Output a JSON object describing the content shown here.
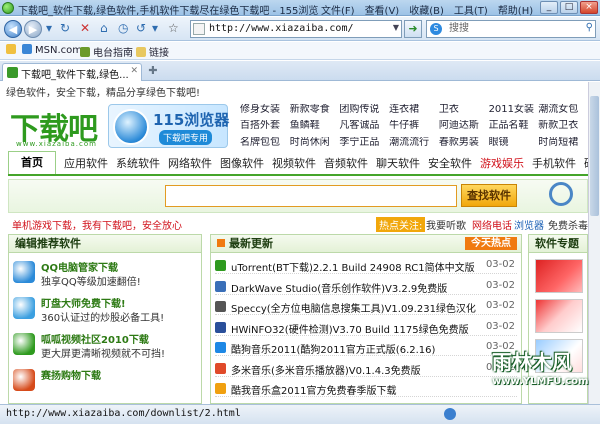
{
  "window": {
    "title": "下载吧_软件下载,绿色软件,手机软件下载尽在绿色下载吧 - 155浏览",
    "menu": [
      "文件(F)",
      "查看(V)",
      "收藏(B)",
      "工具(T)",
      "帮助(H)"
    ],
    "controls": {
      "minimize": "_",
      "maximize": "□",
      "close": "×"
    }
  },
  "navbar": {
    "address": "http://www.xiazaiba.com/",
    "search_placeholder": "搜搜"
  },
  "favorites": [
    {
      "label": "MSN.com",
      "icon": "msn-icon",
      "color": "#3a86d6"
    },
    {
      "label": "电台指南",
      "icon": "radio-icon",
      "color": "#6b9a2a"
    },
    {
      "label": "链接",
      "icon": "folder-icon",
      "color": "#e8c860"
    }
  ],
  "tab": {
    "label": "下载吧_软件下载,绿色..."
  },
  "page": {
    "topline": "绿色软件，安全下载，精品分享绿色下载吧!",
    "logo": {
      "text": "下载吧",
      "url": "www.xiazaiba.com"
    },
    "ad": {
      "title": "115浏览器",
      "subtitle": "下载吧专用"
    },
    "soft_links": [
      {
        "label": "修身女装",
        "red": false
      },
      {
        "label": "新款零食",
        "red": false
      },
      {
        "label": "团购传说",
        "red": false
      },
      {
        "label": "连衣裙",
        "red": false
      },
      {
        "label": "卫衣",
        "red": false
      },
      {
        "label": "2011女装",
        "red": false
      },
      {
        "label": "潮流女包",
        "red": false
      },
      {
        "label": "百搭外套",
        "red": false
      },
      {
        "label": "鱼鳞鞋",
        "red": false
      },
      {
        "label": "凡客诚品",
        "red": false
      },
      {
        "label": "牛仔裤",
        "red": false
      },
      {
        "label": "阿迪达斯",
        "red": false
      },
      {
        "label": "正品名鞋",
        "red": false
      },
      {
        "label": "新款卫衣",
        "red": false
      },
      {
        "label": "名牌包包",
        "red": false
      },
      {
        "label": "时尚休闲",
        "red": false
      },
      {
        "label": "李宁正品",
        "red": false
      },
      {
        "label": "潮流流行",
        "red": false
      },
      {
        "label": "春款男装",
        "red": false
      },
      {
        "label": "眼镜",
        "red": false
      },
      {
        "label": "时尚短裙",
        "red": false
      }
    ],
    "nav_tabs": [
      {
        "label": "首页",
        "active": true,
        "red": false
      },
      {
        "label": "应用软件",
        "active": false,
        "red": false
      },
      {
        "label": "系统软件",
        "active": false,
        "red": false
      },
      {
        "label": "网络软件",
        "active": false,
        "red": false
      },
      {
        "label": "图像软件",
        "active": false,
        "red": false
      },
      {
        "label": "视频软件",
        "active": false,
        "red": false
      },
      {
        "label": "音频软件",
        "active": false,
        "red": false
      },
      {
        "label": "聊天软件",
        "active": false,
        "red": false
      },
      {
        "label": "安全软件",
        "active": false,
        "red": false
      },
      {
        "label": "游戏娱乐",
        "active": false,
        "red": true
      },
      {
        "label": "手机软件",
        "active": false,
        "red": false
      },
      {
        "label": "硬件驱动",
        "active": false,
        "red": false
      }
    ],
    "search_button": "查找软件",
    "notice": "单机游戏下载，我有下载吧，安全放心",
    "hot": {
      "label": "热点关注:",
      "links": [
        {
          "label": "我要听歌",
          "style": ""
        },
        {
          "label": "网络电话",
          "style": "red"
        },
        {
          "label": "浏览器",
          "style": "blue"
        },
        {
          "label": "免费杀毒",
          "style": ""
        },
        {
          "label": "手机",
          "style": ""
        }
      ]
    },
    "left_panel": {
      "title": "编辑推荐软件",
      "items": [
        {
          "title": "QQ电脑管家下载",
          "desc": "独享QQ等级加速翻倍!",
          "icon": "qq-manager-icon",
          "color": "#2b8ad8"
        },
        {
          "title": "盯盘大师免费下载!",
          "desc": "360认证过的炒股必备工具!",
          "icon": "stock-icon",
          "color": "#3b9fe0"
        },
        {
          "title": "呱呱视频社区2010下载",
          "desc": "更大屏更清晰视频就不可挡!",
          "icon": "video-icon",
          "color": "#2e9a1e"
        },
        {
          "title": "赛扬购物下载",
          "desc": "",
          "icon": "shopping-icon",
          "color": "#d64a1a"
        }
      ]
    },
    "mid_panel": {
      "title": "最新更新",
      "badge": "今天热点",
      "rows": [
        {
          "title": "uTorrent(BT下载)2.2.1 Build 24908 RC1简体中文版",
          "date": "03-02",
          "icon": "utorrent-icon",
          "color": "#2e9a1e"
        },
        {
          "title": "DarkWave Studio(音乐创作软件)V3.2.9免费版",
          "date": "03-02",
          "icon": "darkwave-icon",
          "color": "#3a6fb8"
        },
        {
          "title": "Speccy(全方位电脑信息搜集工具)V1.09.231绿色汉化",
          "date": "03-02",
          "icon": "speccy-icon",
          "color": "#555555"
        },
        {
          "title": "HWiNFO32(硬件检测)V3.70 Build 1175绿色免费版",
          "date": "03-02",
          "icon": "hwinfo-icon",
          "color": "#2a4f9a"
        },
        {
          "title": "酷狗音乐2011(酷狗2011官方正式版(6.2.16)",
          "date": "03-02",
          "icon": "kugou-icon",
          "color": "#1e88e5"
        },
        {
          "title": "多米音乐(多米音乐播放器)V0.1.4.3免费版",
          "date": "03-02",
          "icon": "duomi-icon",
          "color": "#e04a2a"
        },
        {
          "title": "酷我音乐盒2011官方免费春季版下载",
          "date": "",
          "icon": "kuwo-icon",
          "color": "#f0a010"
        }
      ]
    },
    "right_panel": {
      "title": "软件专题"
    }
  },
  "watermark": {
    "main": "雨林木风",
    "url": "www.YLMFU.com"
  },
  "status": {
    "text": "http://www.xiazaiba.com/downlist/2.html"
  }
}
